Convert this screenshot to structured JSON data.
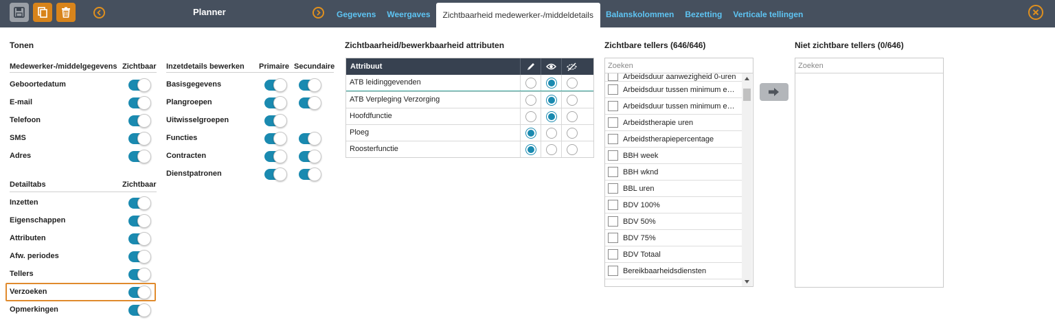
{
  "app": {
    "title": "Planner"
  },
  "tabs": [
    {
      "label": "Gegevens",
      "active": false
    },
    {
      "label": "Weergaves",
      "active": false
    },
    {
      "label": "Zichtbaarheid medewerker-/middeldetails",
      "active": true
    },
    {
      "label": "Balanskolommen",
      "active": false
    },
    {
      "label": "Bezetting",
      "active": false
    },
    {
      "label": "Verticale tellingen",
      "active": false
    }
  ],
  "toolbar": {
    "icons": [
      "save-icon",
      "copy-icon",
      "trash-icon"
    ]
  },
  "tonen": {
    "title": "Tonen",
    "employee_header": "Medewerker-/middelgegevens",
    "visible_header": "Zichtbaar",
    "employee_rows": [
      {
        "label": "Geboortedatum",
        "on": true
      },
      {
        "label": "E-mail",
        "on": true
      },
      {
        "label": "Telefoon",
        "on": true
      },
      {
        "label": "SMS",
        "on": true
      },
      {
        "label": "Adres",
        "on": true
      }
    ],
    "detail_header": "Detailtabs",
    "detail_visible_header": "Zichtbaar",
    "detail_rows": [
      {
        "label": "Inzetten",
        "on": true
      },
      {
        "label": "Eigenschappen",
        "on": true
      },
      {
        "label": "Attributen",
        "on": true
      },
      {
        "label": "Afw. periodes",
        "on": true
      },
      {
        "label": "Tellers",
        "on": true
      },
      {
        "label": "Verzoeken",
        "on": true
      },
      {
        "label": "Opmerkingen",
        "on": true
      }
    ],
    "inzet_header": "Inzetdetails bewerken",
    "primary_header": "Primaire",
    "secondary_header": "Secundaire",
    "inzet_rows": [
      {
        "label": "Basisgegevens",
        "primary": true,
        "secondary": true
      },
      {
        "label": "Plangroepen",
        "primary": true,
        "secondary": true
      },
      {
        "label": "Uitwisselgroepen",
        "primary": true,
        "secondary": null
      },
      {
        "label": "Functies",
        "primary": true,
        "secondary": true
      },
      {
        "label": "Contracten",
        "primary": true,
        "secondary": true
      },
      {
        "label": "Dienstpatronen",
        "primary": true,
        "secondary": true
      }
    ]
  },
  "attributes": {
    "title": "Zichtbaarheid/bewerkbaarheid attributen",
    "column_header": "Attribuut",
    "icons": [
      "pencil-icon",
      "eye-icon",
      "eye-off-icon"
    ],
    "rows": [
      {
        "label": "ATB leidinggevenden",
        "selected": 1
      },
      {
        "label": "ATB Verpleging Verzorging",
        "selected": 1
      },
      {
        "label": "Hoofdfunctie",
        "selected": 1
      },
      {
        "label": "Ploeg",
        "selected": 0
      },
      {
        "label": "Roosterfunctie",
        "selected": 0
      }
    ]
  },
  "visible_counters": {
    "title": "Zichtbare tellers (646/646)",
    "search_placeholder": "Zoeken",
    "items": [
      "Arbeidsduur aanwezigheid 0-uren",
      "Arbeidsduur tussen minimum en maximum",
      "Arbeidsduur tussen minimum en maximum",
      "Arbeidstherapie uren",
      "Arbeidstherapiepercentage",
      "BBH week",
      "BBH wknd",
      "BBL uren",
      "BDV 100%",
      "BDV 50%",
      "BDV 75%",
      "BDV Totaal",
      "Bereikbaarheidsdiensten"
    ]
  },
  "hidden_counters": {
    "title": "Niet zichtbare tellers (0/646)",
    "search_placeholder": "Zoeken"
  },
  "colors": {
    "topbar": "#46505e",
    "accent": "#d8841b",
    "tab_link": "#5ec4f3",
    "toggle_on": "#1a8ab0",
    "highlight": "#e08a2c"
  }
}
